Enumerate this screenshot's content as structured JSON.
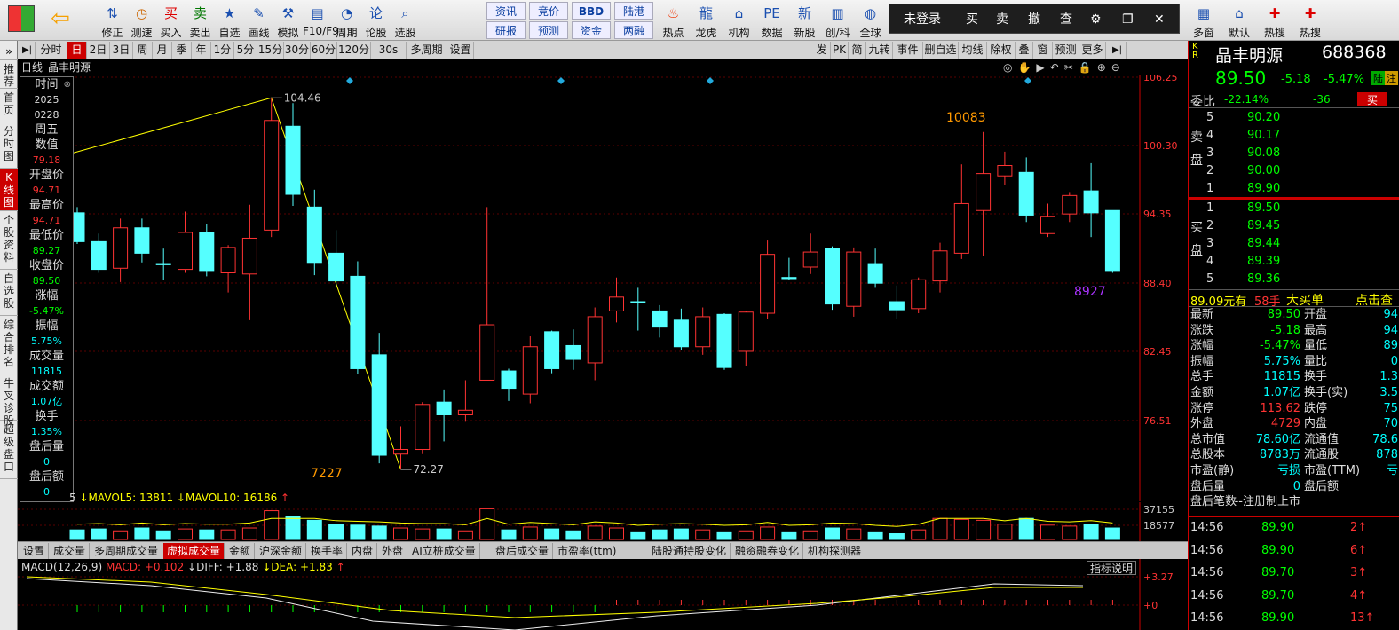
{
  "toolbar": {
    "items": [
      {
        "label": "修正",
        "icon": "up-down-arrow-icon"
      },
      {
        "label": "测速",
        "icon": "clock-icon"
      },
      {
        "label": "买入",
        "icon": "buy-icon"
      },
      {
        "label": "卖出",
        "icon": "sell-icon"
      },
      {
        "label": "自选",
        "icon": "star-folder-icon"
      },
      {
        "label": "画线",
        "icon": "pencil-icon"
      },
      {
        "label": "模拟",
        "icon": "hammer-icon"
      },
      {
        "label": "F10/F9",
        "icon": "document-icon"
      },
      {
        "label": "周期",
        "icon": "period-clock-icon"
      },
      {
        "label": "论股",
        "icon": "chat-icon"
      },
      {
        "label": "选股",
        "icon": "magnify-chart-icon"
      }
    ],
    "info_buttons": [
      "资讯",
      "竞价",
      "BBD",
      "陆港",
      "研报",
      "预测",
      "资金",
      "两融"
    ],
    "items2": [
      {
        "label": "热点",
        "icon": "fire-icon"
      },
      {
        "label": "龙虎",
        "icon": "dragon-icon"
      },
      {
        "label": "机构",
        "icon": "bank-icon"
      },
      {
        "label": "数据",
        "icon": "pe-icon"
      },
      {
        "label": "新股",
        "icon": "new-stock-icon"
      },
      {
        "label": "创/科",
        "icon": "bar-chart-icon"
      },
      {
        "label": "全球",
        "icon": "globe-icon"
      }
    ],
    "right_items": [
      {
        "label": "多窗",
        "icon": "multi-window-icon"
      },
      {
        "label": "默认",
        "icon": "home-icon"
      },
      {
        "label": "热搜",
        "icon": "hot-search-icon"
      },
      {
        "label": "热搜",
        "icon": "hot-search-icon"
      }
    ]
  },
  "login_bar": {
    "status": "未登录",
    "buy": "买",
    "sell": "卖",
    "cancel": "撤",
    "query": "查"
  },
  "sidebar": {
    "collapse": "»",
    "items": [
      "推荐",
      "首页",
      "分时图",
      "K线图",
      "个股资料",
      "自选股",
      "综合排名",
      "牛叉诊股",
      "超级盘口"
    ],
    "active": 3
  },
  "period_bar": {
    "items": [
      "分时",
      "日",
      "2日",
      "3日",
      "周",
      "月",
      "季",
      "年",
      "1分",
      "5分",
      "15分",
      "30分",
      "60分",
      "120分",
      "30s",
      "多周期",
      "设置"
    ],
    "active": "日",
    "right_items": [
      "发",
      "PK",
      "简",
      "九转",
      "事件",
      "删自选",
      "均线",
      "除权",
      "叠",
      "窗",
      "预测",
      "更多"
    ]
  },
  "chart_title": {
    "type": "日线",
    "name": "晶丰明源"
  },
  "info_box": {
    "time_label": "时间",
    "year": "2025",
    "date": "0228",
    "weekday": "周五",
    "rows": [
      {
        "label": "数值",
        "value": "79.18"
      },
      {
        "label": "开盘价",
        "value": "94.71"
      },
      {
        "label": "最高价",
        "value": "94.71"
      },
      {
        "label": "最低价",
        "value": "89.27"
      },
      {
        "label": "收盘价",
        "value": "89.50"
      },
      {
        "label": "涨幅",
        "value": "-5.47%"
      },
      {
        "label": "振幅",
        "value": "5.75%"
      },
      {
        "label": "成交量",
        "value": "11815"
      },
      {
        "label": "成交额",
        "value": "1.07亿"
      },
      {
        "label": "换手",
        "value": "1.35%"
      },
      {
        "label": "盘后量",
        "value": "0"
      },
      {
        "label": "盘后额",
        "value": "0"
      }
    ]
  },
  "chart_data": [
    {
      "type": "candlestick",
      "y_ticks": [
        "106.25",
        "100.30",
        "94.35",
        "88.40",
        "82.45",
        "76.51"
      ],
      "annotations": {
        "high": "104.46",
        "low": "72.27",
        "vol_high": "10083",
        "vol_low": "7227",
        "vol_last": "8927"
      },
      "candles": [
        {
          "o": 94.5,
          "h": 95.0,
          "c": 92.0,
          "l": 91.8
        },
        {
          "o": 92.0,
          "h": 92.7,
          "c": 89.6,
          "l": 89.3
        },
        {
          "o": 89.7,
          "h": 94.0,
          "c": 93.2,
          "l": 88.5
        },
        {
          "o": 93.2,
          "h": 94.0,
          "c": 91.0,
          "l": 90.2
        },
        {
          "o": 90.1,
          "h": 91.4,
          "c": 90.0,
          "l": 88.7
        },
        {
          "o": 89.6,
          "h": 94.6,
          "c": 92.8,
          "l": 89.3
        },
        {
          "o": 92.8,
          "h": 93.5,
          "c": 89.5,
          "l": 89.0
        },
        {
          "o": 89.3,
          "h": 91.7,
          "c": 91.5,
          "l": 87.6
        },
        {
          "o": 89.2,
          "h": 95.2,
          "c": 92.3,
          "l": 85.2
        },
        {
          "o": 93.0,
          "h": 104.4,
          "c": 102.5,
          "l": 92.4
        },
        {
          "o": 102.0,
          "h": 104.0,
          "c": 96.1,
          "l": 95.1
        },
        {
          "o": 95.0,
          "h": 96.5,
          "c": 90.2,
          "l": 89.1
        },
        {
          "o": 91.0,
          "h": 93.0,
          "c": 88.6,
          "l": 88.0
        },
        {
          "o": 89.0,
          "h": 90.3,
          "c": 81.0,
          "l": 80.5
        },
        {
          "o": 82.2,
          "h": 84.1,
          "c": 73.5,
          "l": 72.8
        },
        {
          "o": 73.6,
          "h": 76.0,
          "c": 74.0,
          "l": 72.3
        },
        {
          "o": 74.0,
          "h": 78.1,
          "c": 77.9,
          "l": 73.6
        },
        {
          "o": 78.1,
          "h": 79.2,
          "c": 77.0,
          "l": 74.7
        },
        {
          "o": 77.0,
          "h": 80.0,
          "c": 77.4,
          "l": 76.4
        },
        {
          "o": 80.0,
          "h": 95.0,
          "c": 84.8,
          "l": 80.0
        },
        {
          "o": 80.8,
          "h": 81.0,
          "c": 79.3,
          "l": 78.2
        },
        {
          "o": 78.8,
          "h": 83.8,
          "c": 82.9,
          "l": 78.0
        },
        {
          "o": 84.2,
          "h": 84.3,
          "c": 81.0,
          "l": 80.6
        },
        {
          "o": 83.0,
          "h": 84.4,
          "c": 81.8,
          "l": 80.9
        },
        {
          "o": 81.5,
          "h": 86.3,
          "c": 85.5,
          "l": 80.0
        },
        {
          "o": 86.0,
          "h": 88.9,
          "c": 87.2,
          "l": 85.0
        },
        {
          "o": 86.8,
          "h": 88.0,
          "c": 86.7,
          "l": 84.3
        },
        {
          "o": 86.0,
          "h": 86.5,
          "c": 84.6,
          "l": 83.7
        },
        {
          "o": 85.2,
          "h": 86.2,
          "c": 82.9,
          "l": 82.6
        },
        {
          "o": 82.9,
          "h": 86.3,
          "c": 85.5,
          "l": 82.2
        },
        {
          "o": 85.7,
          "h": 85.8,
          "c": 81.1,
          "l": 80.9
        },
        {
          "o": 82.5,
          "h": 86.0,
          "c": 85.9,
          "l": 81.2
        },
        {
          "o": 85.8,
          "h": 92.1,
          "c": 90.9,
          "l": 85.3
        },
        {
          "o": 88.9,
          "h": 90.6,
          "c": 88.8,
          "l": 88.7
        },
        {
          "o": 89.8,
          "h": 92.7,
          "c": 91.1,
          "l": 89.2
        },
        {
          "o": 91.4,
          "h": 91.6,
          "c": 86.6,
          "l": 86.1
        },
        {
          "o": 86.4,
          "h": 91.5,
          "c": 91.1,
          "l": 85.5
        },
        {
          "o": 90.1,
          "h": 91.4,
          "c": 88.4,
          "l": 88.0
        },
        {
          "o": 86.8,
          "h": 88.2,
          "c": 86.1,
          "l": 85.3
        },
        {
          "o": 86.2,
          "h": 88.9,
          "c": 88.7,
          "l": 85.8
        },
        {
          "o": 88.6,
          "h": 91.9,
          "c": 91.2,
          "l": 87.6
        },
        {
          "o": 91.0,
          "h": 98.7,
          "c": 95.3,
          "l": 90.5
        },
        {
          "o": 94.7,
          "h": 101.5,
          "c": 97.9,
          "l": 90.8
        },
        {
          "o": 97.7,
          "h": 99.8,
          "c": 98.6,
          "l": 96.9
        },
        {
          "o": 98.0,
          "h": 99.3,
          "c": 94.3,
          "l": 93.7
        },
        {
          "o": 92.7,
          "h": 95.3,
          "c": 94.2,
          "l": 92.4
        },
        {
          "o": 94.4,
          "h": 96.3,
          "c": 96.0,
          "l": 93.7
        },
        {
          "o": 96.4,
          "h": 98.8,
          "c": 94.5,
          "l": 92.4
        },
        {
          "o": 94.7,
          "h": 94.7,
          "c": 89.5,
          "l": 89.3
        }
      ]
    },
    {
      "type": "bar",
      "name": "volume",
      "legend": "↓MAVOL5: 13811 ↓MAVOL10: 16186",
      "legend_prefix": "5",
      "y_ticks": [
        "37155",
        "18577"
      ],
      "values": [
        10,
        11,
        9,
        12,
        9,
        11,
        10,
        10,
        12,
        30,
        24,
        20,
        16,
        15,
        14,
        12,
        11,
        11,
        9,
        32,
        10,
        13,
        11,
        9,
        14,
        12,
        8,
        10,
        11,
        10,
        8,
        9,
        13,
        8,
        9,
        12,
        11,
        8,
        6,
        10,
        22,
        21,
        20,
        16,
        22,
        15,
        14,
        16,
        12
      ]
    },
    {
      "type": "line",
      "name": "MACD",
      "legend": {
        "name": "MACD(12,26,9)",
        "macd": "MACD: +0.102",
        "diff": "↓DIFF: +1.88",
        "dea": "↓DEA: +1.83"
      },
      "y_ticks": [
        "+3.27",
        "+0"
      ],
      "button": "指标说明"
    }
  ],
  "volume_tabs": {
    "items": [
      "设置",
      "成交量",
      "多周期成交量",
      "虚拟成交量",
      "金额",
      "沪深金额",
      "换手率",
      "内盘",
      "外盘",
      "AI立桩成交量",
      "盘后成交量",
      "市盈率(ttm)",
      "陆股通持股变化",
      "融资融券变化",
      "机构探测器"
    ],
    "active": 3
  },
  "quote": {
    "code_tag": "K\nR",
    "name": "晶丰明源",
    "code": "688368",
    "price": "89.50",
    "change": "-5.18",
    "pct": "-5.47%",
    "badge1": "陆",
    "badge2": "注",
    "webi_label": "委比",
    "webi": "-22.14%",
    "wecha": "-36",
    "buy_btn": "买",
    "sell_side_label": "卖盘",
    "buy_side_label": "买盘",
    "asks": [
      {
        "level": "5",
        "price": "90.20"
      },
      {
        "level": "4",
        "price": "90.17"
      },
      {
        "level": "3",
        "price": "90.08"
      },
      {
        "level": "2",
        "price": "90.00"
      },
      {
        "level": "1",
        "price": "89.90"
      }
    ],
    "bids": [
      {
        "level": "1",
        "price": "89.50"
      },
      {
        "level": "2",
        "price": "89.45"
      },
      {
        "level": "3",
        "price": "89.44"
      },
      {
        "level": "4",
        "price": "89.39"
      },
      {
        "level": "5",
        "price": "89.36"
      }
    ],
    "big_order": {
      "price": "89.09元有",
      "qty": "58手",
      "label": "大买单",
      "link": "点击查"
    },
    "stats": [
      {
        "l1": "最新",
        "v1": "89.50",
        "l2": "开盘",
        "v2": "94"
      },
      {
        "l1": "涨跌",
        "v1": "-5.18",
        "l2": "最高",
        "v2": "94"
      },
      {
        "l1": "涨幅",
        "v1": "-5.47%",
        "l2": "量低",
        "v2": "89"
      },
      {
        "l1": "振幅",
        "v1": "5.75%",
        "l2": "量比",
        "v2": "0"
      },
      {
        "l1": "总手",
        "v1": "11815",
        "l2": "换手",
        "v2": "1.3"
      },
      {
        "l1": "金额",
        "v1": "1.07亿",
        "l2": "换手(实)",
        "v2": "3.5"
      },
      {
        "l1": "涨停",
        "v1": "113.62",
        "l2": "跌停",
        "v2": "75"
      },
      {
        "l1": "外盘",
        "v1": "4729",
        "l2": "内盘",
        "v2": "70"
      },
      {
        "l1": "总市值",
        "v1": "78.60亿",
        "l2": "流通值",
        "v2": "78.6"
      },
      {
        "l1": "总股本",
        "v1": "8783万",
        "l2": "流通股",
        "v2": "878"
      },
      {
        "l1": "市盈(静)",
        "v1": "亏损",
        "l2": "市盈(TTM)",
        "v2": "亏"
      },
      {
        "l1": "盘后量",
        "v1": "0",
        "l2": "盘后额",
        "v2": ""
      },
      {
        "l1": "盘后笔数",
        "v1": "--注册制上市",
        "l2": "",
        "v2": ""
      }
    ],
    "trades": [
      {
        "time": "14:56",
        "price": "89.90",
        "vol": "2↑"
      },
      {
        "time": "14:56",
        "price": "89.90",
        "vol": "6↑"
      },
      {
        "time": "14:56",
        "price": "89.70",
        "vol": "3↑"
      },
      {
        "time": "14:56",
        "price": "89.70",
        "vol": "4↑"
      },
      {
        "time": "14:56",
        "price": "89.90",
        "vol": "13↑"
      }
    ]
  }
}
